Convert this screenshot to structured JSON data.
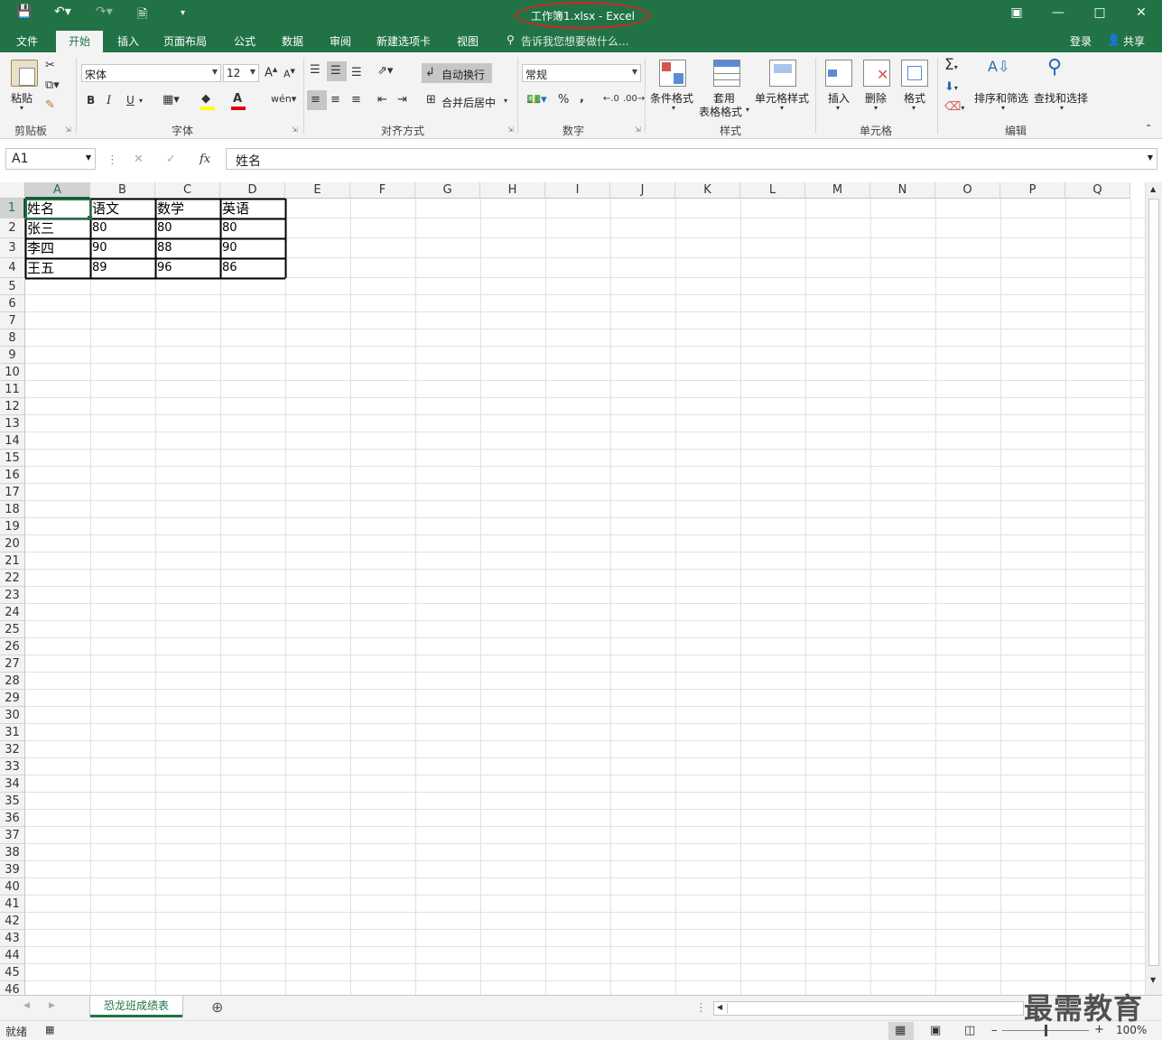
{
  "titlebar": {
    "title": "工作簿1.xlsx - Excel"
  },
  "tabs": {
    "file": "文件",
    "home": "开始",
    "insert": "插入",
    "layout": "页面布局",
    "formulas": "公式",
    "data": "数据",
    "review": "审阅",
    "newtab": "新建选项卡",
    "view": "视图",
    "tellme": "告诉我您想要做什么...",
    "login": "登录",
    "share": "共享"
  },
  "ribbon": {
    "clipboard": {
      "paste": "粘贴",
      "label": "剪贴板"
    },
    "font": {
      "name": "宋体",
      "size": "12",
      "label": "字体"
    },
    "alignment": {
      "wrap": "自动换行",
      "merge": "合并后居中",
      "label": "对齐方式"
    },
    "number": {
      "format": "常规",
      "label": "数字"
    },
    "styles": {
      "conditional": "条件格式",
      "table_a": "套用",
      "table_b": "表格格式",
      "cell_styles": "单元格样式",
      "label": "样式"
    },
    "cells": {
      "insert": "插入",
      "delete": "删除",
      "format": "格式",
      "label": "单元格"
    },
    "editing": {
      "sort": "排序和筛选",
      "find": "查找和选择",
      "label": "编辑"
    }
  },
  "formula_bar": {
    "name_box": "A1",
    "fx": "fx",
    "value": "姓名"
  },
  "grid": {
    "columns": [
      "A",
      "B",
      "C",
      "D",
      "E",
      "F",
      "G",
      "H",
      "I",
      "J",
      "K",
      "L",
      "M",
      "N",
      "O",
      "P",
      "Q"
    ],
    "selected_cell": "A1",
    "rows": [
      [
        "姓名",
        "语文",
        "数学",
        "英语"
      ],
      [
        "张三",
        "80",
        "80",
        "80"
      ],
      [
        "李四",
        "90",
        "88",
        "90"
      ],
      [
        "王五",
        "89",
        "96",
        "86"
      ]
    ],
    "row_count": 46
  },
  "sheet": {
    "active_tab": "恐龙班成绩表"
  },
  "status": {
    "ready": "就绪",
    "zoom": "100%"
  },
  "watermark": "最需教育",
  "colors": {
    "accent": "#217346",
    "title_highlight": "#e0201f"
  }
}
